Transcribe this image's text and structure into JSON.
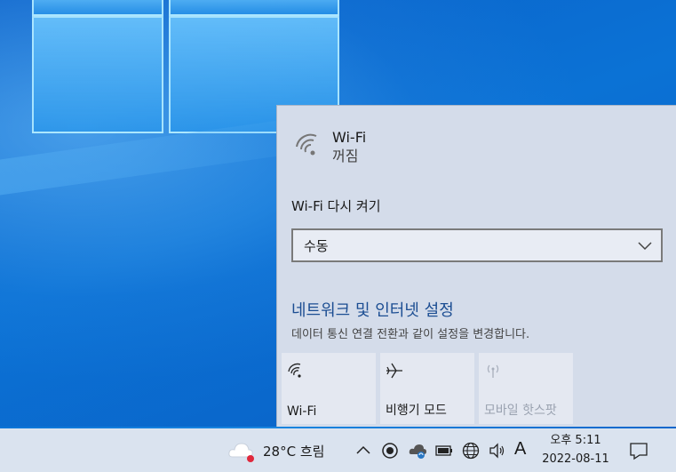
{
  "wifi": {
    "name": "Wi-Fi",
    "state": "꺼짐",
    "reenable_label": "Wi-Fi 다시 켜기",
    "reenable_value": "수동"
  },
  "network": {
    "link": "네트워크 및 인터넷 설정",
    "description": "데이터 통신 연결 전환과 같이 설정을 변경합니다."
  },
  "tiles": [
    {
      "label": "Wi-Fi",
      "icon": "wifi-icon",
      "enabled": true
    },
    {
      "label": "비행기 모드",
      "icon": "airplane-icon",
      "enabled": true
    },
    {
      "label": "모바일 핫스팟",
      "icon": "hotspot-icon",
      "enabled": false
    }
  ],
  "taskbar": {
    "weather": "28°C  흐림",
    "ime": "A",
    "time": "오후 5:11",
    "date": "2022-08-11"
  },
  "colors": {
    "link": "#1b4d92",
    "flyout_bg": "#d4dcea",
    "taskbar_bg": "#dae3ef",
    "weather_alert": "#e0283c"
  }
}
